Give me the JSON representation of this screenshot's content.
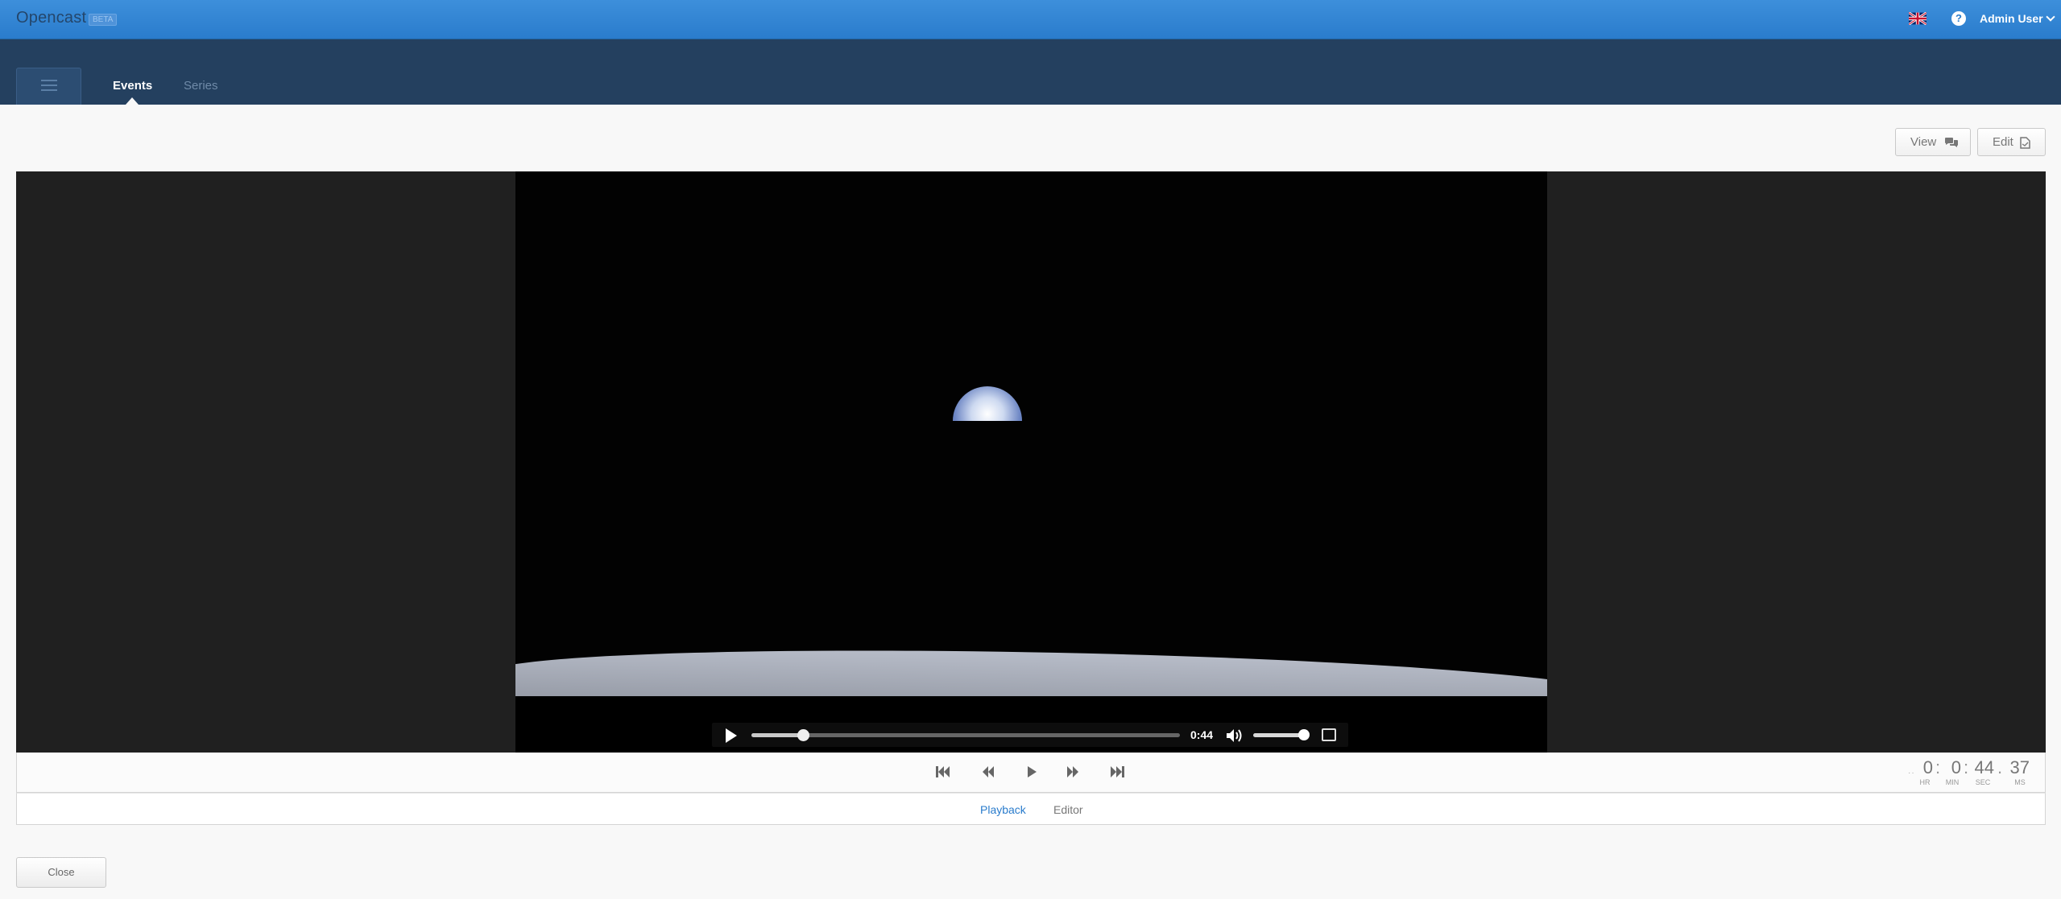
{
  "app": {
    "title": "Opencast",
    "badge": "BETA"
  },
  "header": {
    "user_label": "Admin User",
    "help_label": "?",
    "language_icon": "flag-uk-icon"
  },
  "nav": {
    "tabs": [
      {
        "label": "Events",
        "active": true
      },
      {
        "label": "Series",
        "active": false
      }
    ]
  },
  "actions": {
    "view_label": "View",
    "edit_label": "Edit"
  },
  "player": {
    "current_time": "0:44",
    "progress_fraction": 0.12,
    "volume_fraction": 0.9
  },
  "timecode": {
    "hours": "0",
    "minutes": "0",
    "seconds": "44",
    "ms": "37",
    "labels": {
      "hr": "HR",
      "min": "MIN",
      "sec": "SEC",
      "ms": "MS"
    }
  },
  "modes": {
    "playback_label": "Playback",
    "editor_label": "Editor",
    "active": "Playback"
  },
  "footer": {
    "close_label": "Close"
  },
  "colors": {
    "topbar": "#2a7ccc",
    "navbar": "#24405f",
    "accent": "#2a7ccc"
  }
}
